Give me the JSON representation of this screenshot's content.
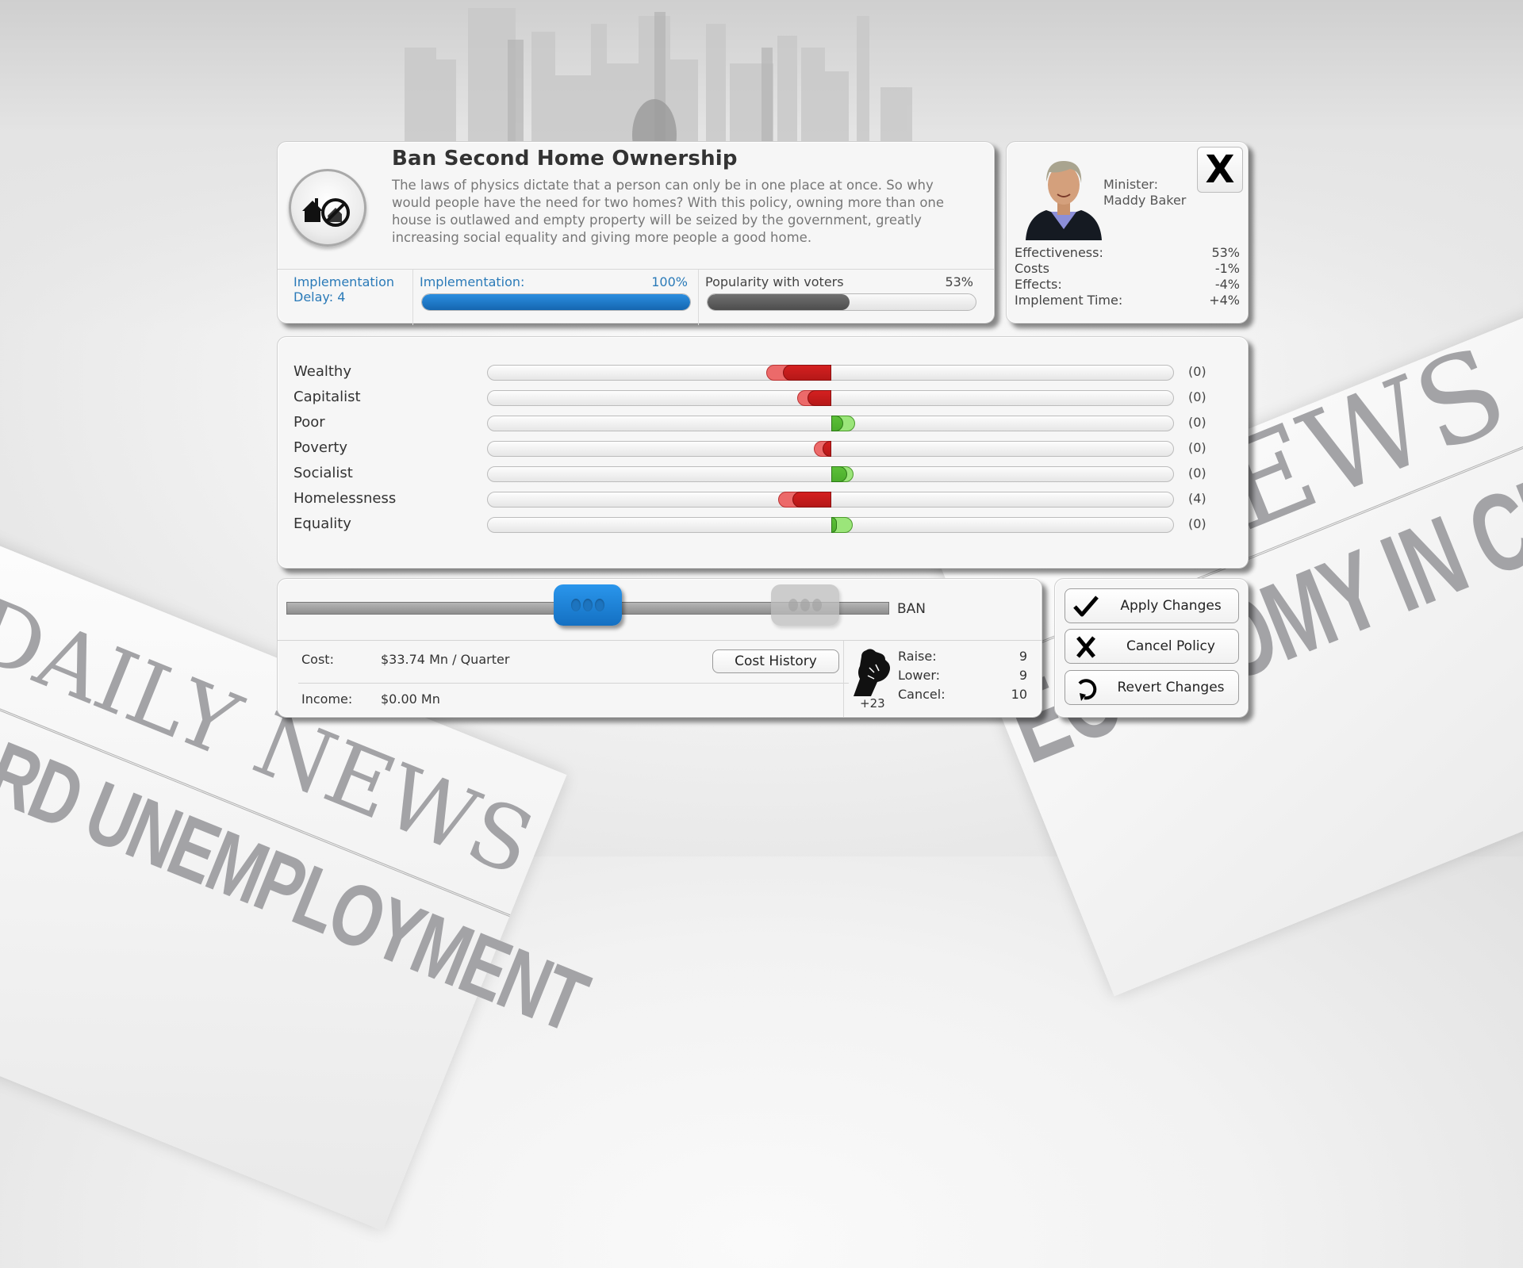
{
  "background": {
    "newspaper_left": {
      "masthead": "DAILY NEWS",
      "headline": "RECORD UNEMPLOYMENT"
    },
    "newspaper_right": {
      "masthead": "NEWS",
      "headline": "ECONOMY IN CRISIS"
    }
  },
  "policy": {
    "title": "Ban Second Home Ownership",
    "icon": "house-ban-icon",
    "description": "The laws of physics dictate that a person can only be in one place at once. So why would people have the need for two homes? With this policy, owning more than one house is outlawed and empty property will be seized by the government, greatly increasing social equality and giving more people a good home.",
    "implementation_delay_label": "Implementation",
    "implementation_delay_value": "Delay: 4",
    "implementation_label": "Implementation:",
    "implementation_value": "100%",
    "implementation_fraction": 1.0,
    "popularity_label": "Popularity with voters",
    "popularity_value": "53%",
    "popularity_fraction": 0.53,
    "colors": {
      "implementation": "#1f7ccc",
      "popularity": "#5f5f5f",
      "accent_text": "#2a7ab8"
    }
  },
  "minister": {
    "role_label": "Minister:",
    "name": "Maddy Baker",
    "close_label": "X",
    "stats": [
      {
        "label": "Effectiveness:",
        "value": "53%"
      },
      {
        "label": "Costs",
        "value": "-1%"
      },
      {
        "label": "Effects:",
        "value": "-4%"
      },
      {
        "label": "Implement Time:",
        "value": "+4%"
      }
    ]
  },
  "effects": {
    "note": "bar extents as fraction of half-track, negative=left(red), positive=right(green); current=dark segment, future=light segment",
    "colors": {
      "negative_dark": "#d42020",
      "negative_light": "#ec6a6a",
      "positive_dark": "#4cae2c",
      "positive_light": "#9be57a"
    },
    "rows": [
      {
        "label": "Wealthy",
        "value": "(0)",
        "current": -0.14,
        "future": -0.19
      },
      {
        "label": "Capitalist",
        "value": "(0)",
        "current": -0.07,
        "future": -0.1
      },
      {
        "label": "Poor",
        "value": "(0)",
        "current": 0.035,
        "future": 0.07
      },
      {
        "label": "Poverty",
        "value": "(0)",
        "current": -0.025,
        "future": -0.05
      },
      {
        "label": "Socialist",
        "value": "(0)",
        "current": 0.046,
        "future": 0.065
      },
      {
        "label": "Homelessness",
        "value": "(4)",
        "current": -0.113,
        "future": -0.155
      },
      {
        "label": "Equality",
        "value": "(0)",
        "current": 0.016,
        "future": 0.062
      }
    ]
  },
  "slider": {
    "end_label": "BAN",
    "current_position": 0.5,
    "ghost_position": 0.86,
    "cost_label": "Cost:",
    "cost_value": "$33.74 Mn / Quarter",
    "income_label": "Income:",
    "income_value": "$0.00 Mn",
    "cost_history_label": "Cost History",
    "political_capital": "+23",
    "votes": [
      {
        "label": "Raise:",
        "value": "9"
      },
      {
        "label": "Lower:",
        "value": "9"
      },
      {
        "label": "Cancel:",
        "value": "10"
      }
    ]
  },
  "actions": {
    "apply_label": "Apply Changes",
    "cancel_label": "Cancel Policy",
    "revert_label": "Revert Changes"
  }
}
